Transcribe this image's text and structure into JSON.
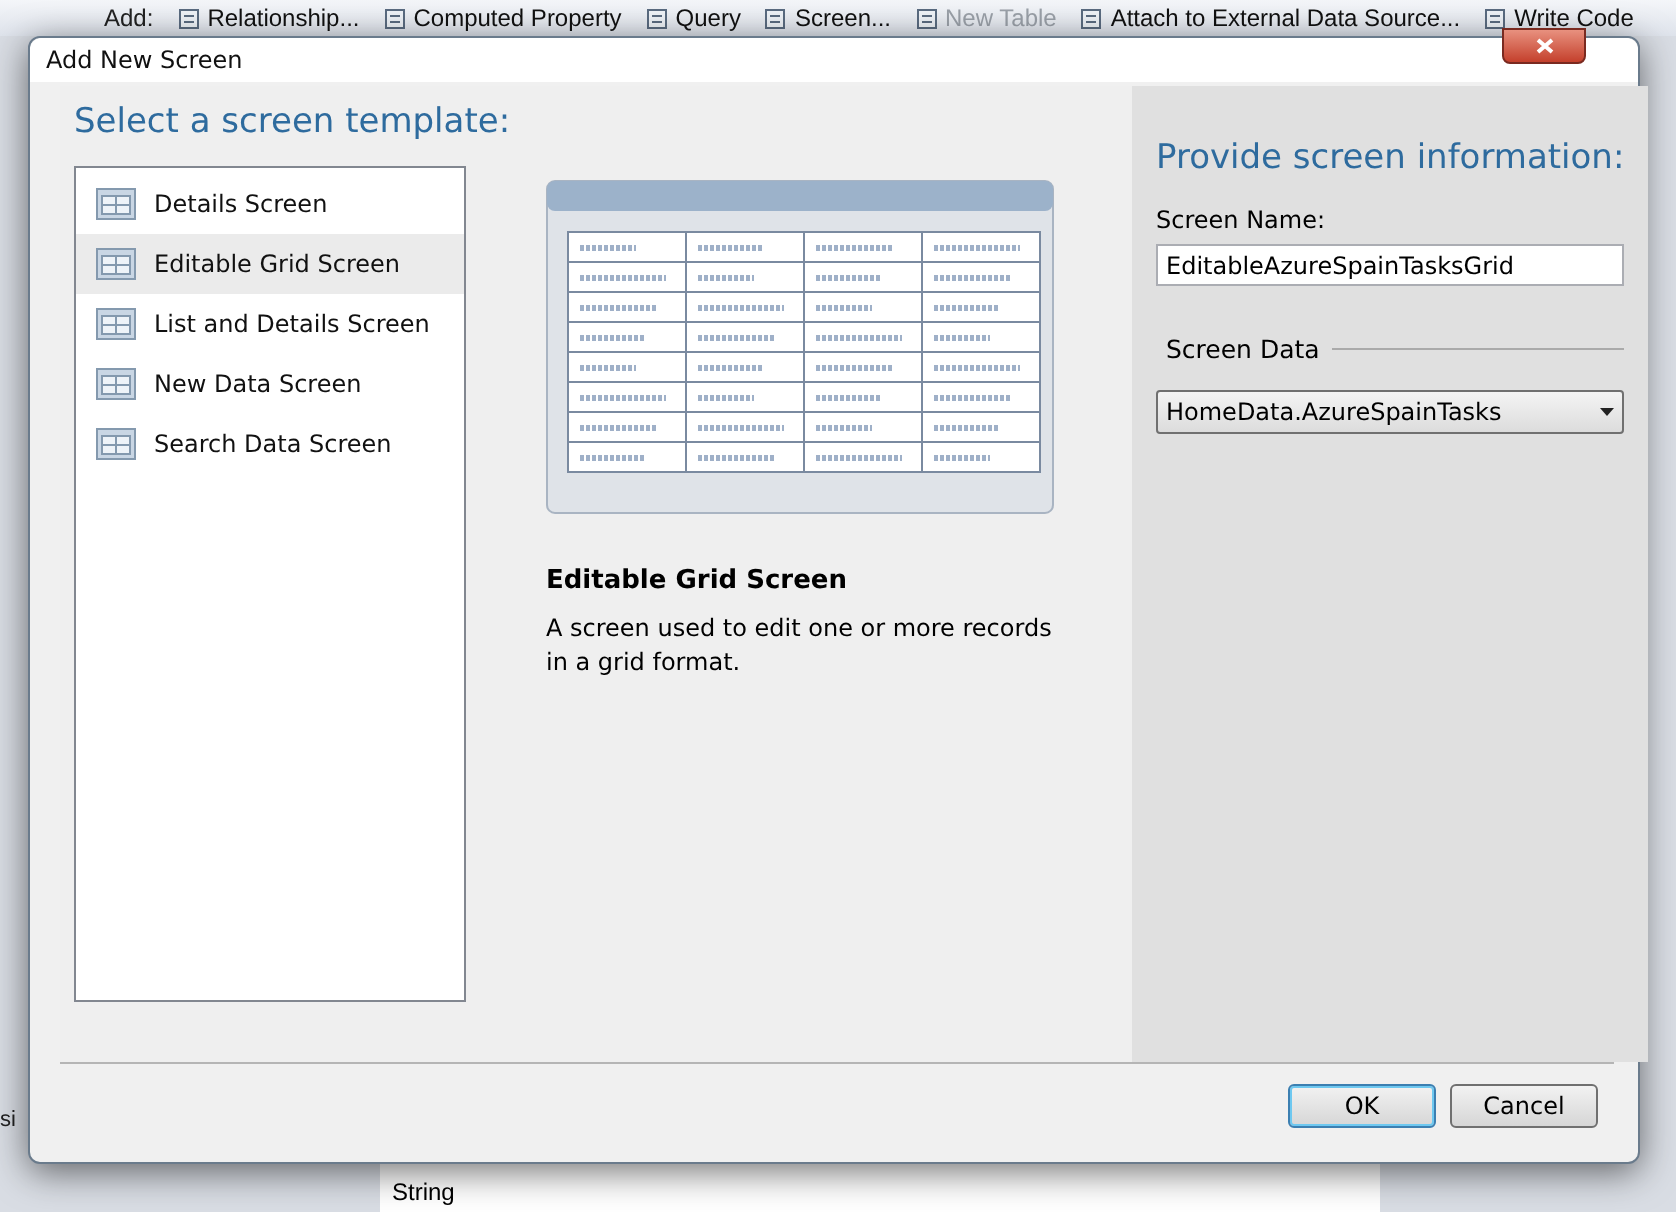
{
  "toolbar": {
    "label": "Add:",
    "items": [
      {
        "label": "Relationship...",
        "disabled": false
      },
      {
        "label": "Computed Property",
        "disabled": false
      },
      {
        "label": "Query",
        "disabled": false
      },
      {
        "label": "Screen...",
        "disabled": false
      },
      {
        "label": "New Table",
        "disabled": true
      },
      {
        "label": "Attach to External Data Source...",
        "disabled": false
      },
      {
        "label": "Write Code",
        "disabled": false
      }
    ]
  },
  "background": {
    "side_text": "si",
    "rows": [
      "String"
    ]
  },
  "dialog": {
    "title": "Add New Screen",
    "template_heading": "Select a screen template:",
    "templates": [
      {
        "label": "Details Screen",
        "selected": false
      },
      {
        "label": "Editable Grid Screen",
        "selected": true
      },
      {
        "label": "List and Details Screen",
        "selected": false
      },
      {
        "label": "New Data Screen",
        "selected": false
      },
      {
        "label": "Search Data Screen",
        "selected": false
      }
    ],
    "preview_title": "Editable Grid Screen",
    "preview_description": "A screen used to edit one or more records in a grid format.",
    "info_heading": "Provide screen information:",
    "screen_name_label": "Screen Name:",
    "screen_name_value": "EditableAzureSpainTasksGrid",
    "screen_data_label": "Screen Data",
    "screen_data_value": "HomeData.AzureSpainTasks",
    "buttons": [
      {
        "label": "OK",
        "default": true
      },
      {
        "label": "Cancel",
        "default": false
      }
    ]
  }
}
